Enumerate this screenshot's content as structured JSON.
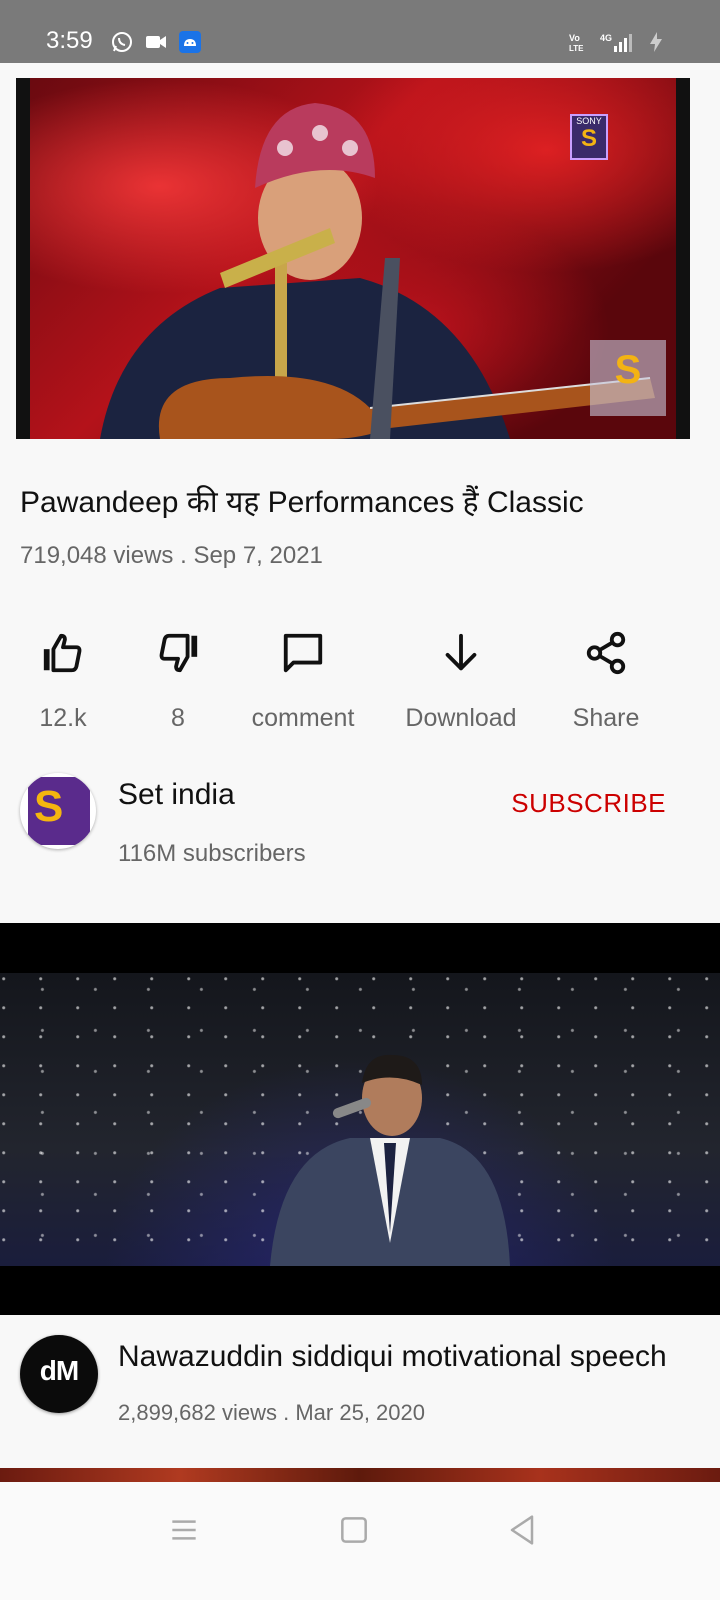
{
  "status_bar": {
    "time": "3:59",
    "left_icons": [
      "whatsapp-icon",
      "video-camera-icon",
      "android-icon"
    ],
    "right_icons": [
      "volte-icon",
      "4g-signal-icon",
      "charging-icon"
    ]
  },
  "video": {
    "title": "Pawandeep की यह Performances हैं Classic",
    "views": "719,048 views",
    "date": "Sep 7, 2021",
    "stats_separator": " . ",
    "watermark_text": "SONY"
  },
  "actions": [
    {
      "name": "like",
      "label": "12.k"
    },
    {
      "name": "dislike",
      "label": "8"
    },
    {
      "name": "comment",
      "label": "comment"
    },
    {
      "name": "download",
      "label": "Download"
    },
    {
      "name": "share",
      "label": "Share"
    }
  ],
  "channel": {
    "name": "Set india",
    "subscribers": "116M subscribers",
    "subscribe_label": "SUBSCRIBE"
  },
  "next_video": {
    "title": "Nawazuddin siddiqui motivational speech",
    "views": "2,899,682 views",
    "date": "Mar 25, 2020",
    "avatar_text": "dM"
  },
  "colors": {
    "subscribe": "#cc0000",
    "status_bar": "#7a7a7a"
  }
}
